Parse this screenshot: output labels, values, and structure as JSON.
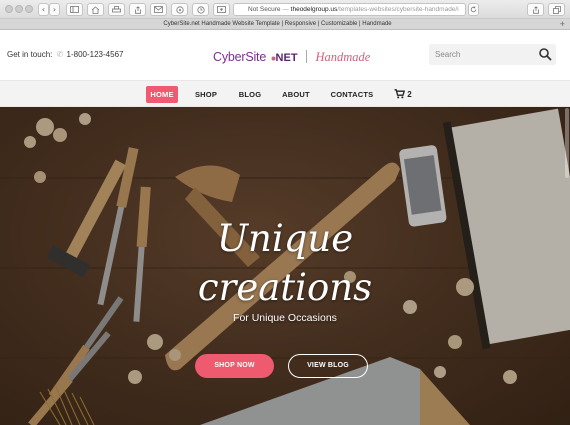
{
  "browser": {
    "security_label": "Not Secure",
    "url_host": "theodelgroup.us",
    "url_path": "/templates-websites/cybersite-handmade/i",
    "tab_title": "CyberSite.net Handmade Website Template | Responsive | Customizable | Handmade",
    "back_icon": "‹",
    "forward_icon": "›",
    "new_tab_icon": "+"
  },
  "header": {
    "contact_label": "Get in touch:",
    "phone": "1-800-123-4567",
    "logo_main": "CyberSite",
    "logo_net": "NET",
    "logo_script": "Handmade",
    "search_placeholder": "Search"
  },
  "nav": {
    "items": [
      {
        "label": "HOME"
      },
      {
        "label": "SHOP"
      },
      {
        "label": "BLOG"
      },
      {
        "label": "ABOUT"
      },
      {
        "label": "CONTACTS"
      }
    ],
    "cart_count": "2"
  },
  "hero": {
    "title_line1": "Unique",
    "title_line2": "creations",
    "subtitle": "For Unique Occasions",
    "primary_button": "SHOP NOW",
    "secondary_button": "VIEW BLOG"
  },
  "colors": {
    "accent": "#ee5a6f",
    "logo_purple": "#7c2f90",
    "logo_pink": "#d6607b"
  }
}
